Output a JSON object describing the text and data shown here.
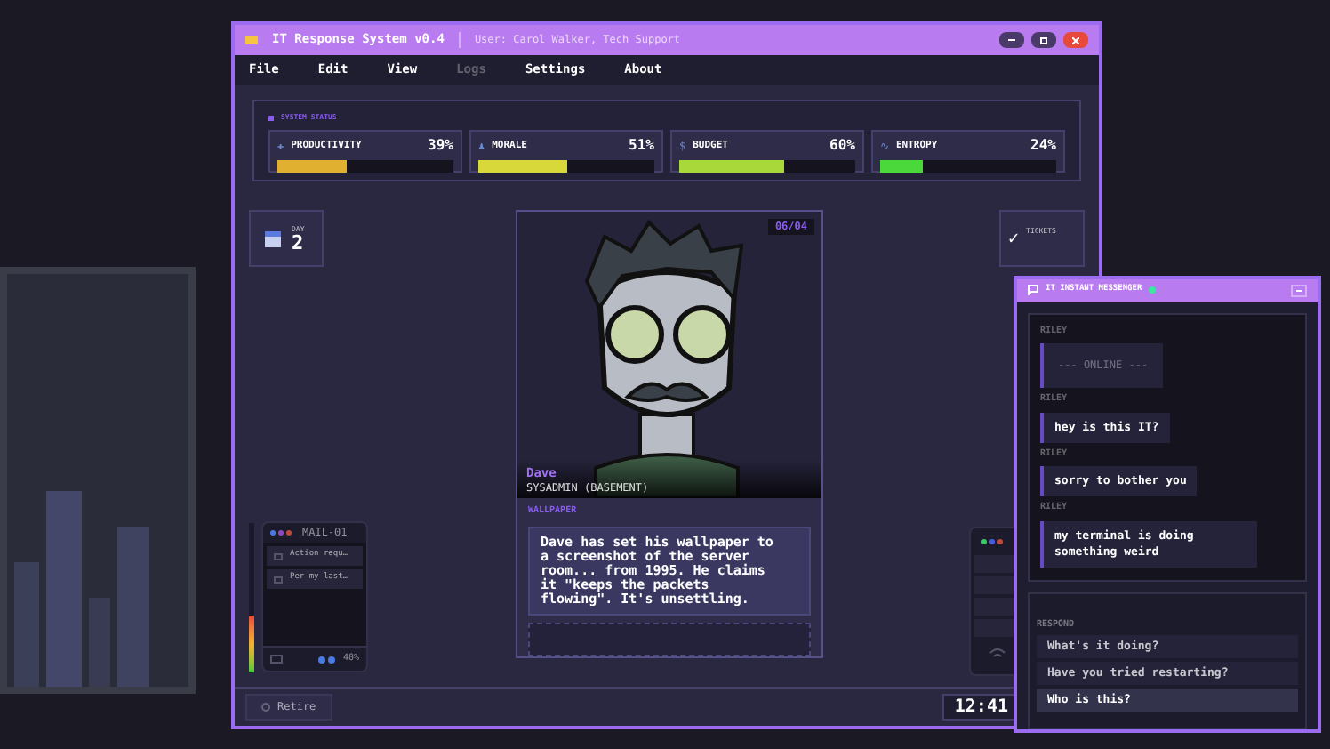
{
  "window": {
    "title": "IT Response System v0.4",
    "user": "User: Carol Walker, Tech Support"
  },
  "menu": [
    {
      "label": "File",
      "disabled": false
    },
    {
      "label": "Edit",
      "disabled": false
    },
    {
      "label": "View",
      "disabled": false
    },
    {
      "label": "Logs",
      "disabled": true
    },
    {
      "label": "Settings",
      "disabled": false
    },
    {
      "label": "About",
      "disabled": false
    }
  ],
  "system_status": {
    "title": "SYSTEM STATUS",
    "meters": [
      {
        "icon": "✚",
        "label": "PRODUCTIVITY",
        "reading": "39%",
        "level": 0.39,
        "color": "#e0b030"
      },
      {
        "icon": "♟",
        "label": "MORALE",
        "reading": "51%",
        "level": 0.51,
        "color": "#d8d83a"
      },
      {
        "icon": "$",
        "label": "BUDGET",
        "reading": "60%",
        "level": 0.6,
        "color": "#a8d83a"
      },
      {
        "icon": "∿",
        "label": "ENTROPY",
        "reading": "24%",
        "level": 0.24,
        "color": "#4ad83a"
      }
    ]
  },
  "day": {
    "label": "DAY",
    "value": "2"
  },
  "tickets": {
    "icon": "✓",
    "label": "TICKETS"
  },
  "card": {
    "tag": "06/04",
    "name": "Dave",
    "role": "SYSADMIN (BASEMENT)",
    "section": "WALLPAPER",
    "text": "Dave has set his wallpaper to a screenshot of the server room... from 1995. He claims it \"keeps the packets flowing\". It's unsettling."
  },
  "mail_widget": {
    "title": "MAIL-01",
    "items": [
      "Action requ…",
      "Per my last…"
    ],
    "battery": "40%",
    "meter": {
      "level": 0.38
    }
  },
  "bottom": {
    "retire": "Retire",
    "clock": "12:41"
  },
  "messenger": {
    "title": "IT INSTANT MESSENGER",
    "online": true,
    "messages": [
      {
        "sender": "RILEY",
        "kind": "system",
        "text": "--- ONLINE ---"
      },
      {
        "sender": "RILEY",
        "kind": "text",
        "text": "hey is this IT?"
      },
      {
        "sender": "RILEY",
        "kind": "text",
        "text": "sorry to bother you"
      },
      {
        "sender": "RILEY",
        "kind": "text",
        "text": "my terminal is doing something weird"
      }
    ],
    "respond_label": "RESPOND",
    "options": [
      {
        "text": "What's it doing?",
        "selected": false
      },
      {
        "text": "Have you tried restarting?",
        "selected": false
      },
      {
        "text": "Who is this?",
        "selected": true
      }
    ]
  }
}
